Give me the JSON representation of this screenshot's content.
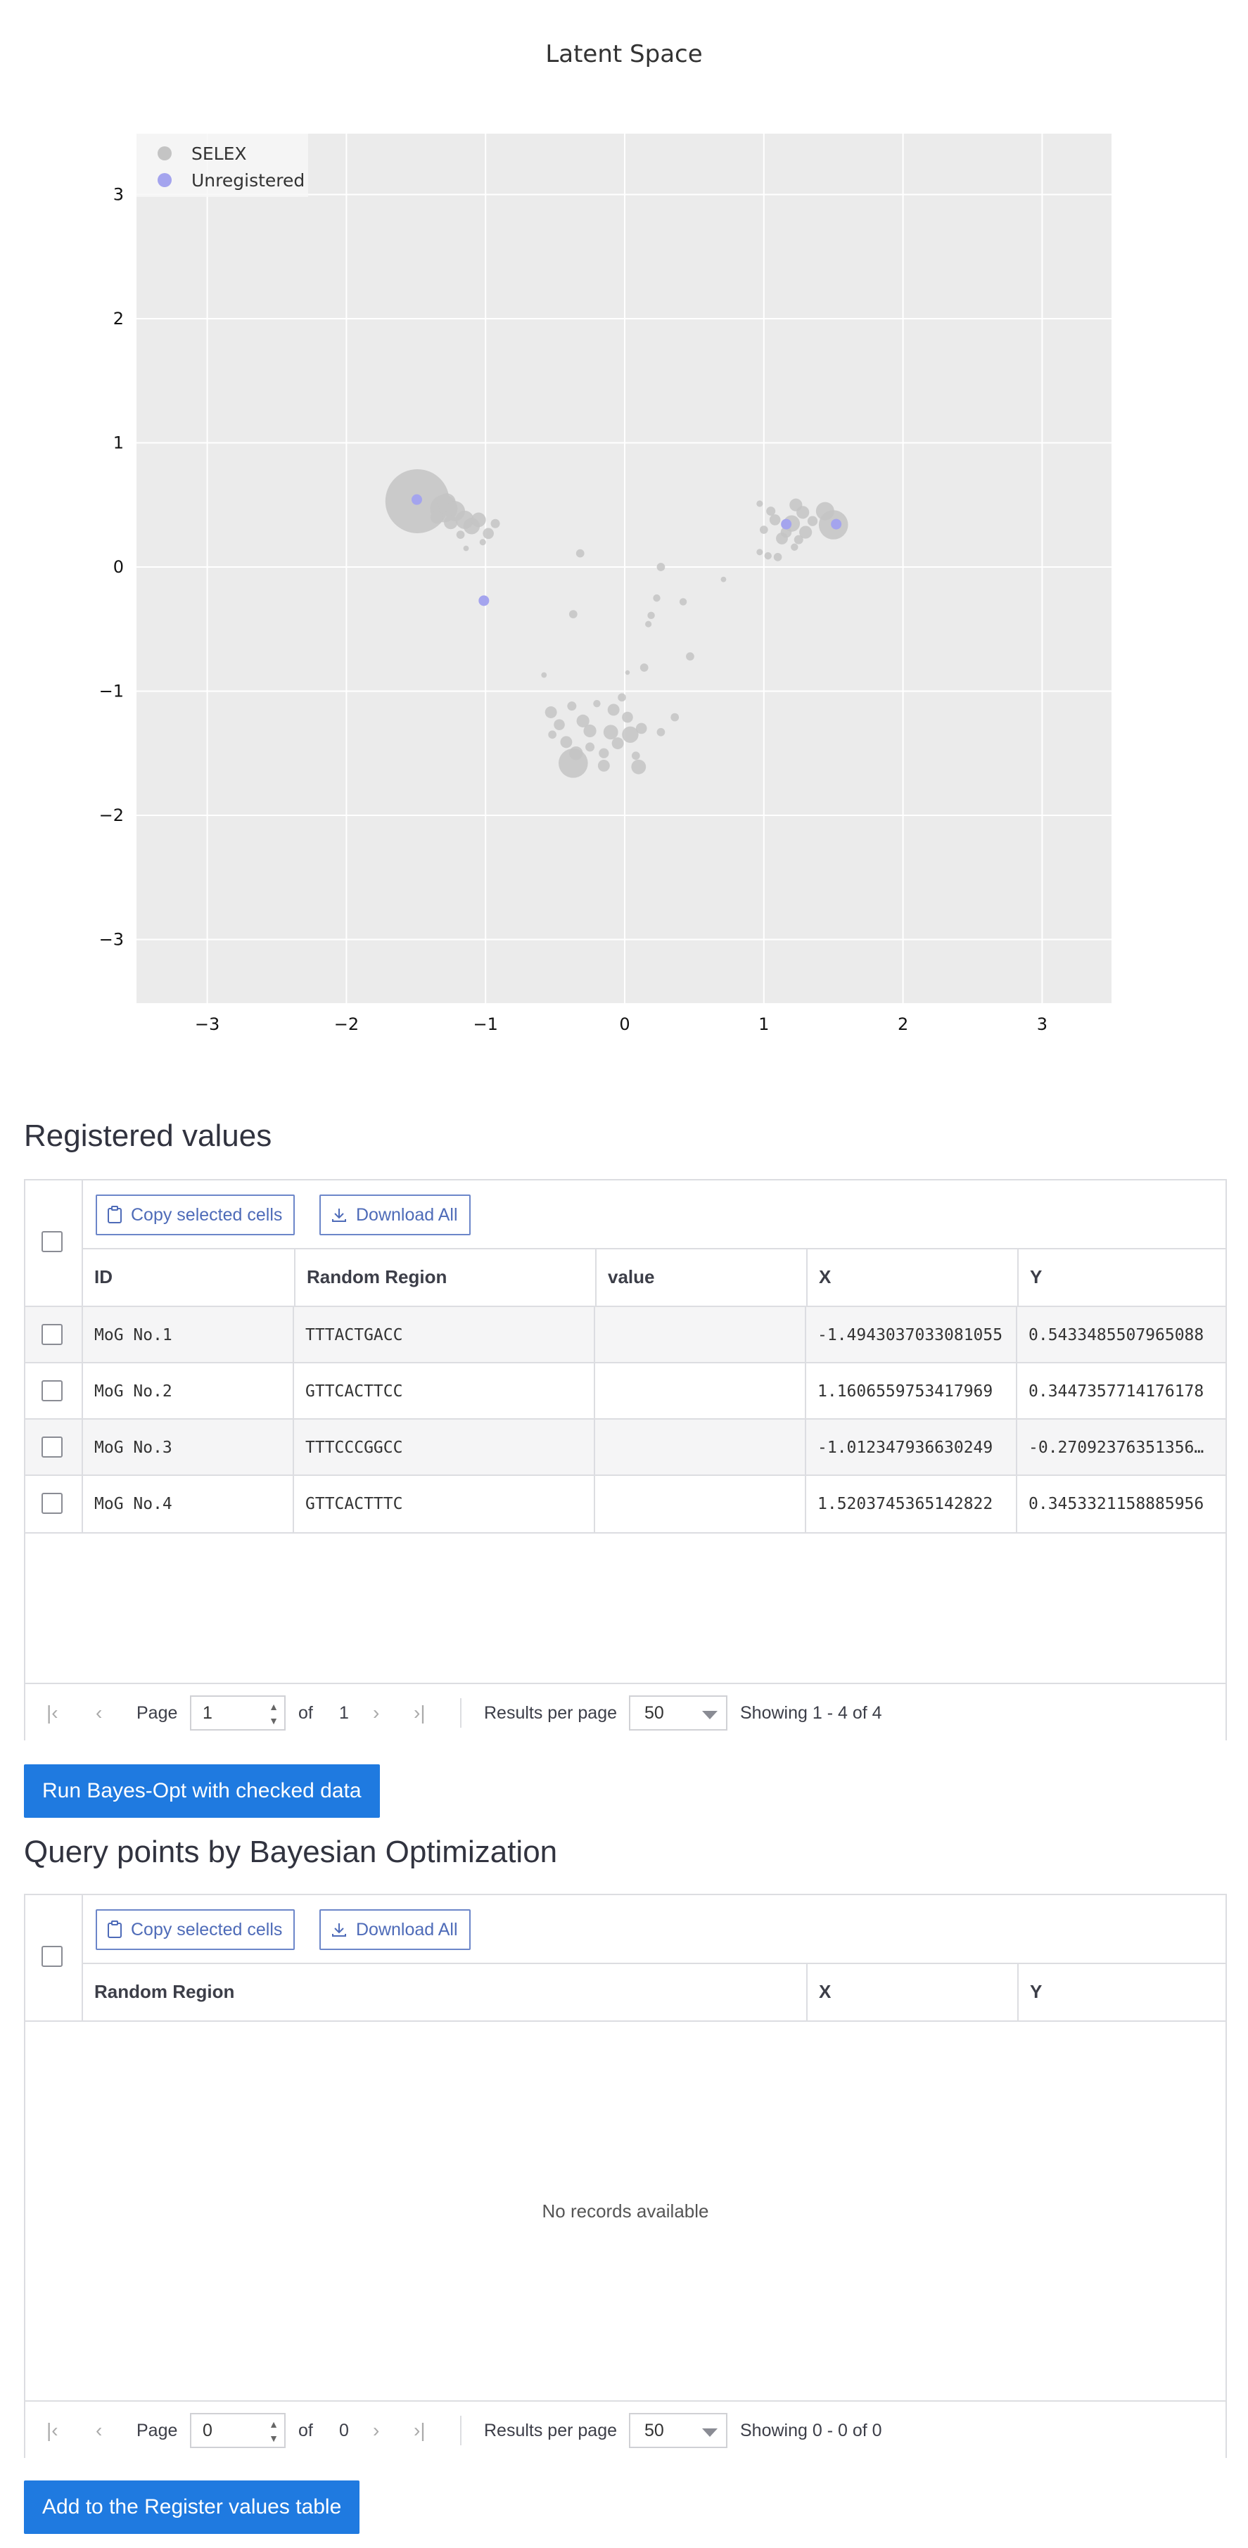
{
  "chart_data": {
    "type": "scatter",
    "title": "Latent Space",
    "xlabel": "",
    "ylabel": "",
    "xlim": [
      -3.5,
      3.5
    ],
    "ylim": [
      -3.5,
      3.5
    ],
    "x_ticks": [
      "−3",
      "−2",
      "−1",
      "0",
      "1",
      "2",
      "3"
    ],
    "y_ticks": [
      "3",
      "2",
      "1",
      "0",
      "−1",
      "−2",
      "−3"
    ],
    "grid": true,
    "legend_position": "top-left",
    "colors": {
      "SELEX": "#c4c4c4",
      "Unregistered": "#a4a4ee",
      "background": "#ebebeb"
    },
    "series": [
      {
        "name": "SELEX",
        "points": [
          {
            "x": -1.49,
            "y": 0.53,
            "s": 7.0
          },
          {
            "x": -1.3,
            "y": 0.47,
            "s": 3.0
          },
          {
            "x": -1.28,
            "y": 0.52,
            "s": 2.0
          },
          {
            "x": -1.22,
            "y": 0.45,
            "s": 2.2
          },
          {
            "x": -1.15,
            "y": 0.38,
            "s": 2.0
          },
          {
            "x": -1.1,
            "y": 0.33,
            "s": 1.8
          },
          {
            "x": -1.05,
            "y": 0.38,
            "s": 1.6
          },
          {
            "x": -0.98,
            "y": 0.27,
            "s": 1.2
          },
          {
            "x": -0.93,
            "y": 0.35,
            "s": 1.0
          },
          {
            "x": -1.18,
            "y": 0.26,
            "s": 0.9
          },
          {
            "x": -1.14,
            "y": 0.15,
            "s": 0.6
          },
          {
            "x": -1.02,
            "y": 0.2,
            "s": 0.7
          },
          {
            "x": -1.35,
            "y": 0.4,
            "s": 1.4
          },
          {
            "x": -1.25,
            "y": 0.36,
            "s": 1.5
          },
          {
            "x": -0.32,
            "y": 0.11,
            "s": 0.9
          },
          {
            "x": -0.37,
            "y": -0.38,
            "s": 0.9
          },
          {
            "x": 0.26,
            "y": 0.0,
            "s": 0.9
          },
          {
            "x": 0.71,
            "y": -0.1,
            "s": 0.6
          },
          {
            "x": 0.23,
            "y": -0.25,
            "s": 0.8
          },
          {
            "x": 0.42,
            "y": -0.28,
            "s": 0.8
          },
          {
            "x": 0.19,
            "y": -0.39,
            "s": 0.8
          },
          {
            "x": 0.17,
            "y": -0.46,
            "s": 0.7
          },
          {
            "x": 0.47,
            "y": -0.72,
            "s": 0.9
          },
          {
            "x": 0.02,
            "y": -0.85,
            "s": 0.5
          },
          {
            "x": 0.14,
            "y": -0.81,
            "s": 0.9
          },
          {
            "x": -0.58,
            "y": -0.87,
            "s": 0.6
          },
          {
            "x": -0.53,
            "y": -1.17,
            "s": 1.3
          },
          {
            "x": -0.47,
            "y": -1.27,
            "s": 1.2
          },
          {
            "x": -0.38,
            "y": -1.12,
            "s": 1.0
          },
          {
            "x": -0.3,
            "y": -1.24,
            "s": 1.4
          },
          {
            "x": -0.2,
            "y": -1.1,
            "s": 0.8
          },
          {
            "x": -0.08,
            "y": -1.15,
            "s": 1.3
          },
          {
            "x": -0.02,
            "y": -1.05,
            "s": 0.9
          },
          {
            "x": 0.02,
            "y": -1.21,
            "s": 1.2
          },
          {
            "x": -0.1,
            "y": -1.33,
            "s": 1.6
          },
          {
            "x": 0.04,
            "y": -1.35,
            "s": 1.8
          },
          {
            "x": 0.12,
            "y": -1.3,
            "s": 1.2
          },
          {
            "x": -0.25,
            "y": -1.32,
            "s": 1.4
          },
          {
            "x": -0.42,
            "y": -1.41,
            "s": 1.3
          },
          {
            "x": -0.35,
            "y": -1.5,
            "s": 1.5
          },
          {
            "x": -0.25,
            "y": -1.45,
            "s": 1.0
          },
          {
            "x": -0.15,
            "y": -1.5,
            "s": 1.1
          },
          {
            "x": -0.05,
            "y": -1.42,
            "s": 1.3
          },
          {
            "x": 0.08,
            "y": -1.52,
            "s": 0.9
          },
          {
            "x": 0.1,
            "y": -1.61,
            "s": 1.6
          },
          {
            "x": -0.37,
            "y": -1.58,
            "s": 3.2
          },
          {
            "x": -0.15,
            "y": -1.6,
            "s": 1.3
          },
          {
            "x": 0.26,
            "y": -1.33,
            "s": 0.9
          },
          {
            "x": 0.36,
            "y": -1.21,
            "s": 0.9
          },
          {
            "x": -0.52,
            "y": -1.35,
            "s": 0.9
          },
          {
            "x": 0.97,
            "y": 0.51,
            "s": 0.7
          },
          {
            "x": 1.05,
            "y": 0.45,
            "s": 1.0
          },
          {
            "x": 1.0,
            "y": 0.3,
            "s": 0.9
          },
          {
            "x": 1.08,
            "y": 0.38,
            "s": 1.2
          },
          {
            "x": 1.13,
            "y": 0.23,
            "s": 1.3
          },
          {
            "x": 1.2,
            "y": 0.35,
            "s": 1.8
          },
          {
            "x": 1.23,
            "y": 0.5,
            "s": 1.4
          },
          {
            "x": 1.28,
            "y": 0.44,
            "s": 1.4
          },
          {
            "x": 1.3,
            "y": 0.28,
            "s": 1.4
          },
          {
            "x": 1.35,
            "y": 0.37,
            "s": 1.1
          },
          {
            "x": 1.44,
            "y": 0.45,
            "s": 2.0
          },
          {
            "x": 1.5,
            "y": 0.34,
            "s": 3.2
          },
          {
            "x": 1.03,
            "y": 0.09,
            "s": 0.8
          },
          {
            "x": 1.1,
            "y": 0.08,
            "s": 0.9
          },
          {
            "x": 0.97,
            "y": 0.12,
            "s": 0.7
          },
          {
            "x": 1.25,
            "y": 0.22,
            "s": 1.0
          },
          {
            "x": 1.16,
            "y": 0.28,
            "s": 1.2
          },
          {
            "x": 1.22,
            "y": 0.16,
            "s": 0.8
          }
        ]
      },
      {
        "name": "Unregistered",
        "points": [
          {
            "x": -1.494,
            "y": 0.543,
            "s": 1.0
          },
          {
            "x": 1.161,
            "y": 0.345,
            "s": 1.0
          },
          {
            "x": -1.012,
            "y": -0.271,
            "s": 1.0
          },
          {
            "x": 1.52,
            "y": 0.345,
            "s": 1.0
          }
        ]
      }
    ]
  },
  "registered": {
    "title": "Registered values",
    "toolbar": {
      "copy_label": "Copy selected cells",
      "download_label": "Download All"
    },
    "columns": [
      "ID",
      "Random Region",
      "value",
      "X",
      "Y"
    ],
    "rows": [
      {
        "id": "MoG No.1",
        "region": "TTTACTGACC",
        "value": "",
        "x": "-1.4943037033081055",
        "y": "0.5433485507965088"
      },
      {
        "id": "MoG No.2",
        "region": "GTTCACTTCC",
        "value": "",
        "x": "1.1606559753417969",
        "y": "0.3447357714176178"
      },
      {
        "id": "MoG No.3",
        "region": "TTTCCCGGCC",
        "value": "",
        "x": "-1.012347936630249",
        "y": "-0.27092376351356…"
      },
      {
        "id": "MoG No.4",
        "region": "GTTCACTTTC",
        "value": "",
        "x": "1.5203745365142822",
        "y": "0.3453321158885956"
      }
    ],
    "pager": {
      "page_label": "Page",
      "page": "1",
      "of_label": "of",
      "total_pages": "1",
      "rpp_label": "Results per page",
      "rpp": "50",
      "showing": "Showing 1 - 4 of 4"
    },
    "run_button": "Run Bayes-Opt with checked data"
  },
  "query": {
    "title": "Query points by Bayesian Optimization",
    "toolbar": {
      "copy_label": "Copy selected cells",
      "download_label": "Download All"
    },
    "columns": [
      "Random Region",
      "X",
      "Y"
    ],
    "empty_text": "No records available",
    "pager": {
      "page_label": "Page",
      "page": "0",
      "of_label": "of",
      "total_pages": "0",
      "rpp_label": "Results per page",
      "rpp": "50",
      "showing": "Showing 0 - 0 of 0"
    },
    "add_button": "Add to the Register values table"
  }
}
